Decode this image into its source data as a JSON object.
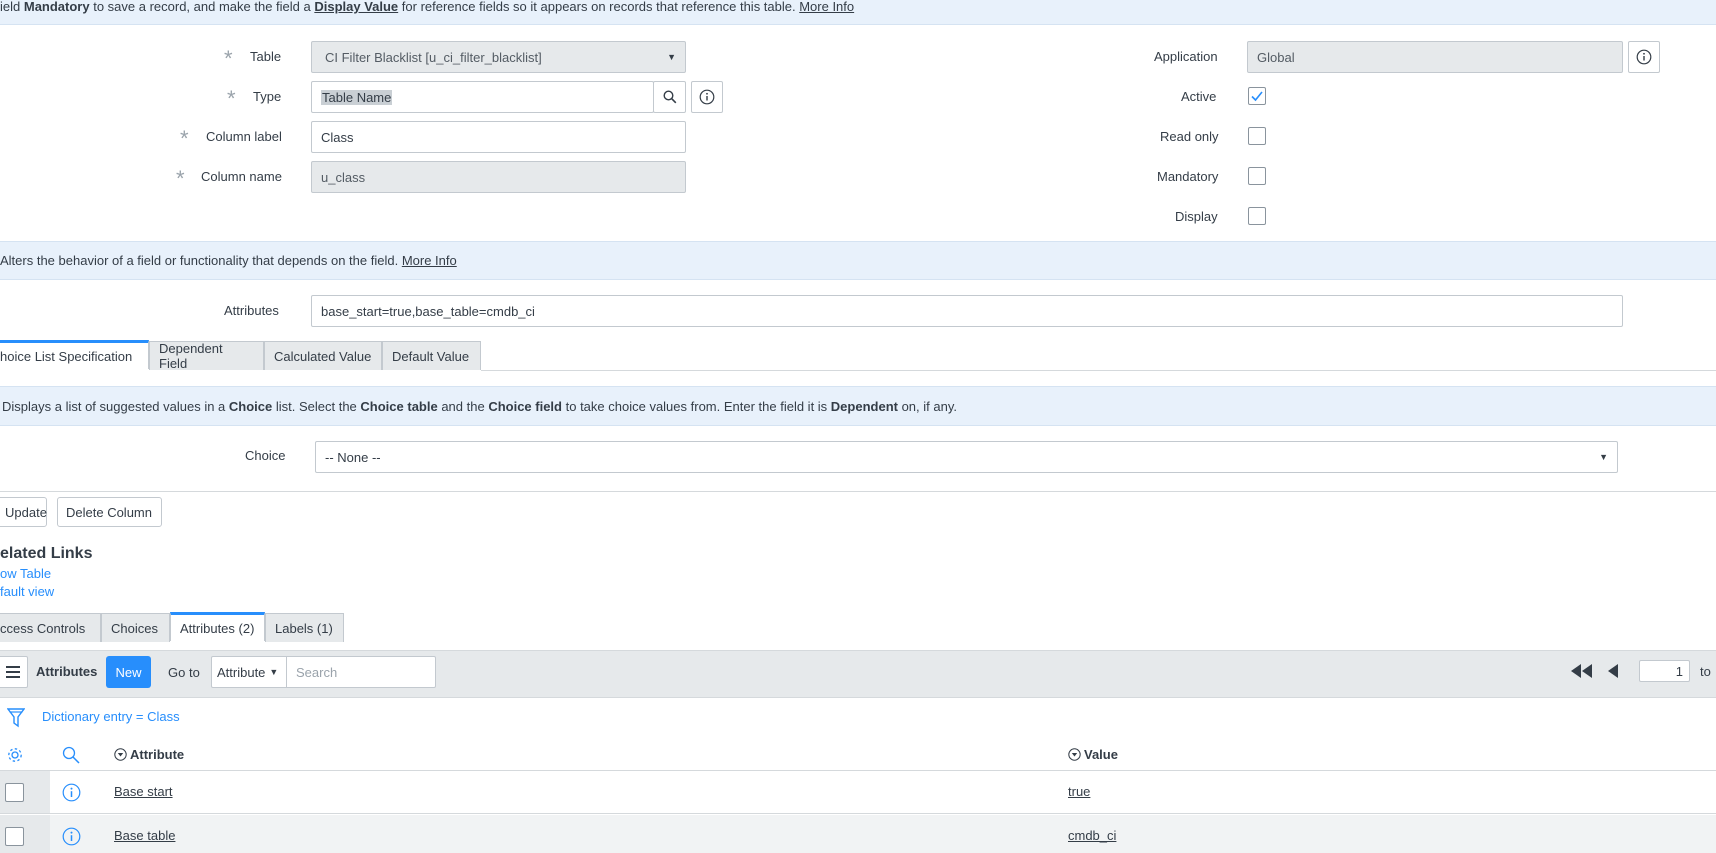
{
  "top_banner": {
    "p1": "ield ",
    "b1": "Mandatory",
    "p2": " to save a record, and make the field a ",
    "b2": "Display Value",
    "p3": " for reference fields so it appears on records that reference this table. ",
    "link": "More Info"
  },
  "form": {
    "table_label": "Table",
    "table_value": "CI Filter Blacklist [u_ci_filter_blacklist]",
    "type_label": "Type",
    "type_value": "Table Name",
    "column_label_label": "Column label",
    "column_label_value": "Class",
    "column_name_label": "Column name",
    "column_name_value": "u_class",
    "application_label": "Application",
    "application_value": "Global",
    "active_label": "Active",
    "active_checked": true,
    "read_only_label": "Read only",
    "mandatory_label": "Mandatory",
    "display_label": "Display"
  },
  "attr_banner": {
    "text": "Alters the behavior of a field or functionality that depends on the field. ",
    "link": "More Info"
  },
  "attributes": {
    "label": "Attributes",
    "value": "base_start=true,base_table=cmdb_ci"
  },
  "section_tabs": [
    "hoice List Specification",
    "Dependent Field",
    "Calculated Value",
    "Default Value"
  ],
  "choice_banner": {
    "p1": "Displays a list of suggested values in a ",
    "b1": "Choice",
    "p2": " list. Select the ",
    "b2": "Choice table",
    "p3": " and the ",
    "b3": "Choice field",
    "p4": " to take choice values from. Enter the field it is ",
    "b4": "Dependent",
    "p5": " on, if any."
  },
  "choice": {
    "label": "Choice",
    "value": "-- None --"
  },
  "buttons": {
    "update": "Update",
    "delete": "Delete Column"
  },
  "related_links": {
    "title": "elated Links",
    "links": [
      "ow Table",
      "fault view"
    ]
  },
  "related_tabs": [
    "ccess Controls",
    "Choices",
    "Attributes (2)",
    "Labels (1)"
  ],
  "list": {
    "title": "Attributes",
    "new_label": "New",
    "goto_label": "Go to",
    "goto_select": "Attribute",
    "search_placeholder": "Search",
    "page_value": "1",
    "page_to": "to",
    "filter_text": "Dictionary entry = Class",
    "columns": [
      "Attribute",
      "Value"
    ],
    "rows": [
      {
        "attribute": "Base start",
        "value": "true"
      },
      {
        "attribute": "Base table",
        "value": "cmdb_ci"
      }
    ]
  },
  "colors": {
    "accent": "#278efc",
    "banner_bg": "#e8f1fb",
    "header_bg": "#e6e9eb"
  }
}
